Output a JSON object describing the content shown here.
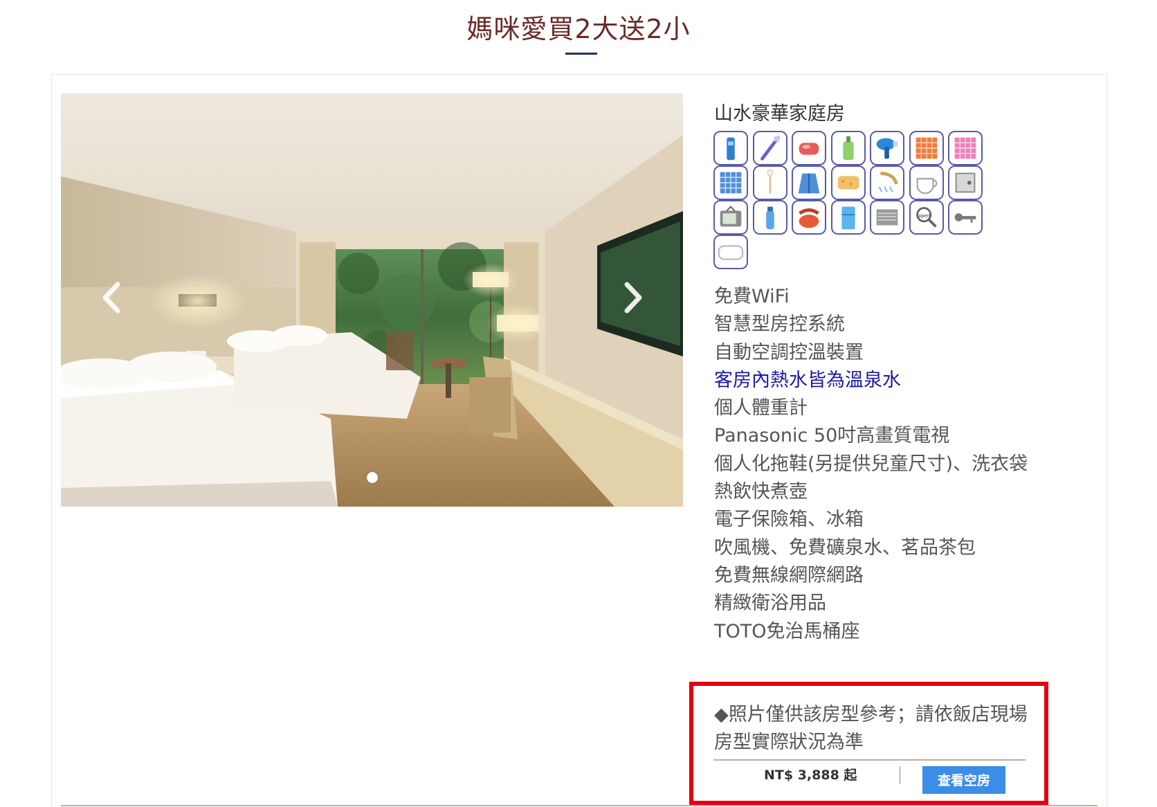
{
  "promo": {
    "title": "媽咪愛買2大送2小"
  },
  "carousel": {
    "prev_icon": "chevron-left-icon",
    "next_icon": "chevron-right-icon",
    "slide_count": 1,
    "active_slide": 1
  },
  "room": {
    "name": "山水豪華家庭房",
    "amenity_icons": [
      "toothbrush-cup-icon",
      "toothbrush-icon",
      "soap-icon",
      "shampoo-bottle-icon",
      "hair-dryer-icon",
      "orange-towel-icon",
      "pink-towel-icon",
      "blue-towel-icon",
      "cotton-swab-icon",
      "bathrobe-icon",
      "sponge-icon",
      "shower-icon",
      "teacup-icon",
      "safe-box-icon",
      "television-icon",
      "water-bottle-icon",
      "telephone-icon",
      "refrigerator-icon",
      "air-conditioner-icon",
      "open-sign-icon",
      "room-key-icon",
      "pillow-icon"
    ],
    "features": [
      {
        "text": "免費WiFi",
        "highlight": false
      },
      {
        "text": "智慧型房控系統",
        "highlight": false
      },
      {
        "text": "自動空調控溫裝置",
        "highlight": false
      },
      {
        "text": "客房內熱水皆為溫泉水",
        "highlight": true
      },
      {
        "text": "個人體重計",
        "highlight": false
      },
      {
        "text": "Panasonic 50吋高畫質電視",
        "highlight": false
      },
      {
        "text": "個人化拖鞋(另提供兒童尺寸)、洗衣袋",
        "highlight": false
      },
      {
        "text": "熱飲快煮壺",
        "highlight": false
      },
      {
        "text": "電子保險箱、冰箱",
        "highlight": false
      },
      {
        "text": "吹風機、免費礦泉水、茗品茶包",
        "highlight": false
      },
      {
        "text": "免費無線網際網路",
        "highlight": false
      },
      {
        "text": "精緻衛浴用品",
        "highlight": false
      },
      {
        "text": "TOTO免治馬桶座",
        "highlight": false
      }
    ],
    "notice": "◆照片僅供該房型參考；請依飯店現場房型實際狀況為準",
    "price": "NT$ 3,888 起",
    "book_label": "查看空房"
  },
  "colors": {
    "title": "#6b2a2a",
    "highlight_feature": "#1a1aa6",
    "button": "#3b8de8",
    "notice_border": "#e3000f"
  }
}
